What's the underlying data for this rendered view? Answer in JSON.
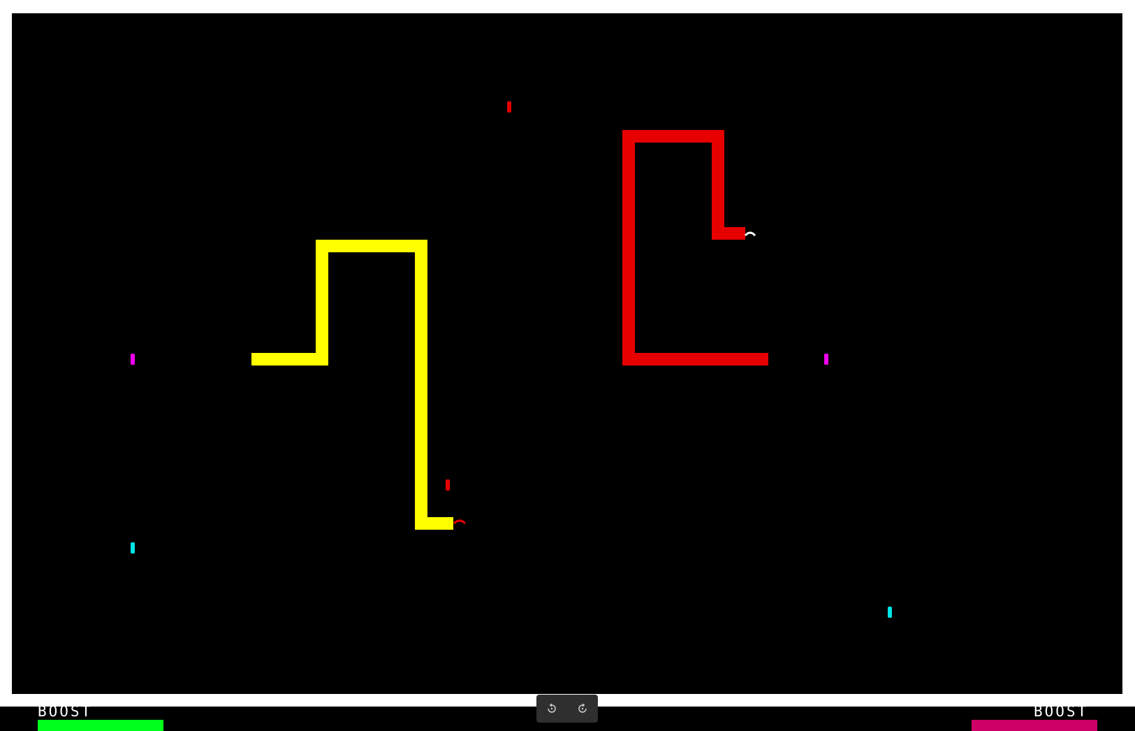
{
  "colors": {
    "frame": "#ffffff",
    "arena": "#000000",
    "player_yellow": "#ffff00",
    "player_red": "#e60000",
    "pickup_red": "#e60000",
    "pickup_magenta": "#ee00ee",
    "pickup_cyan": "#00e5e5",
    "boost_left": "#00ff1a",
    "boost_right": "#cc0066",
    "controls_bg": "#2f2f2f"
  },
  "hud": {
    "left": {
      "label": "BOOST",
      "fill": 1.0
    },
    "right": {
      "label": "BOOST",
      "fill": 1.0
    }
  },
  "controls": {
    "rotate_left_icon": "rotate-counterclockwise-icon",
    "rotate_right_icon": "rotate-clockwise-icon"
  }
}
